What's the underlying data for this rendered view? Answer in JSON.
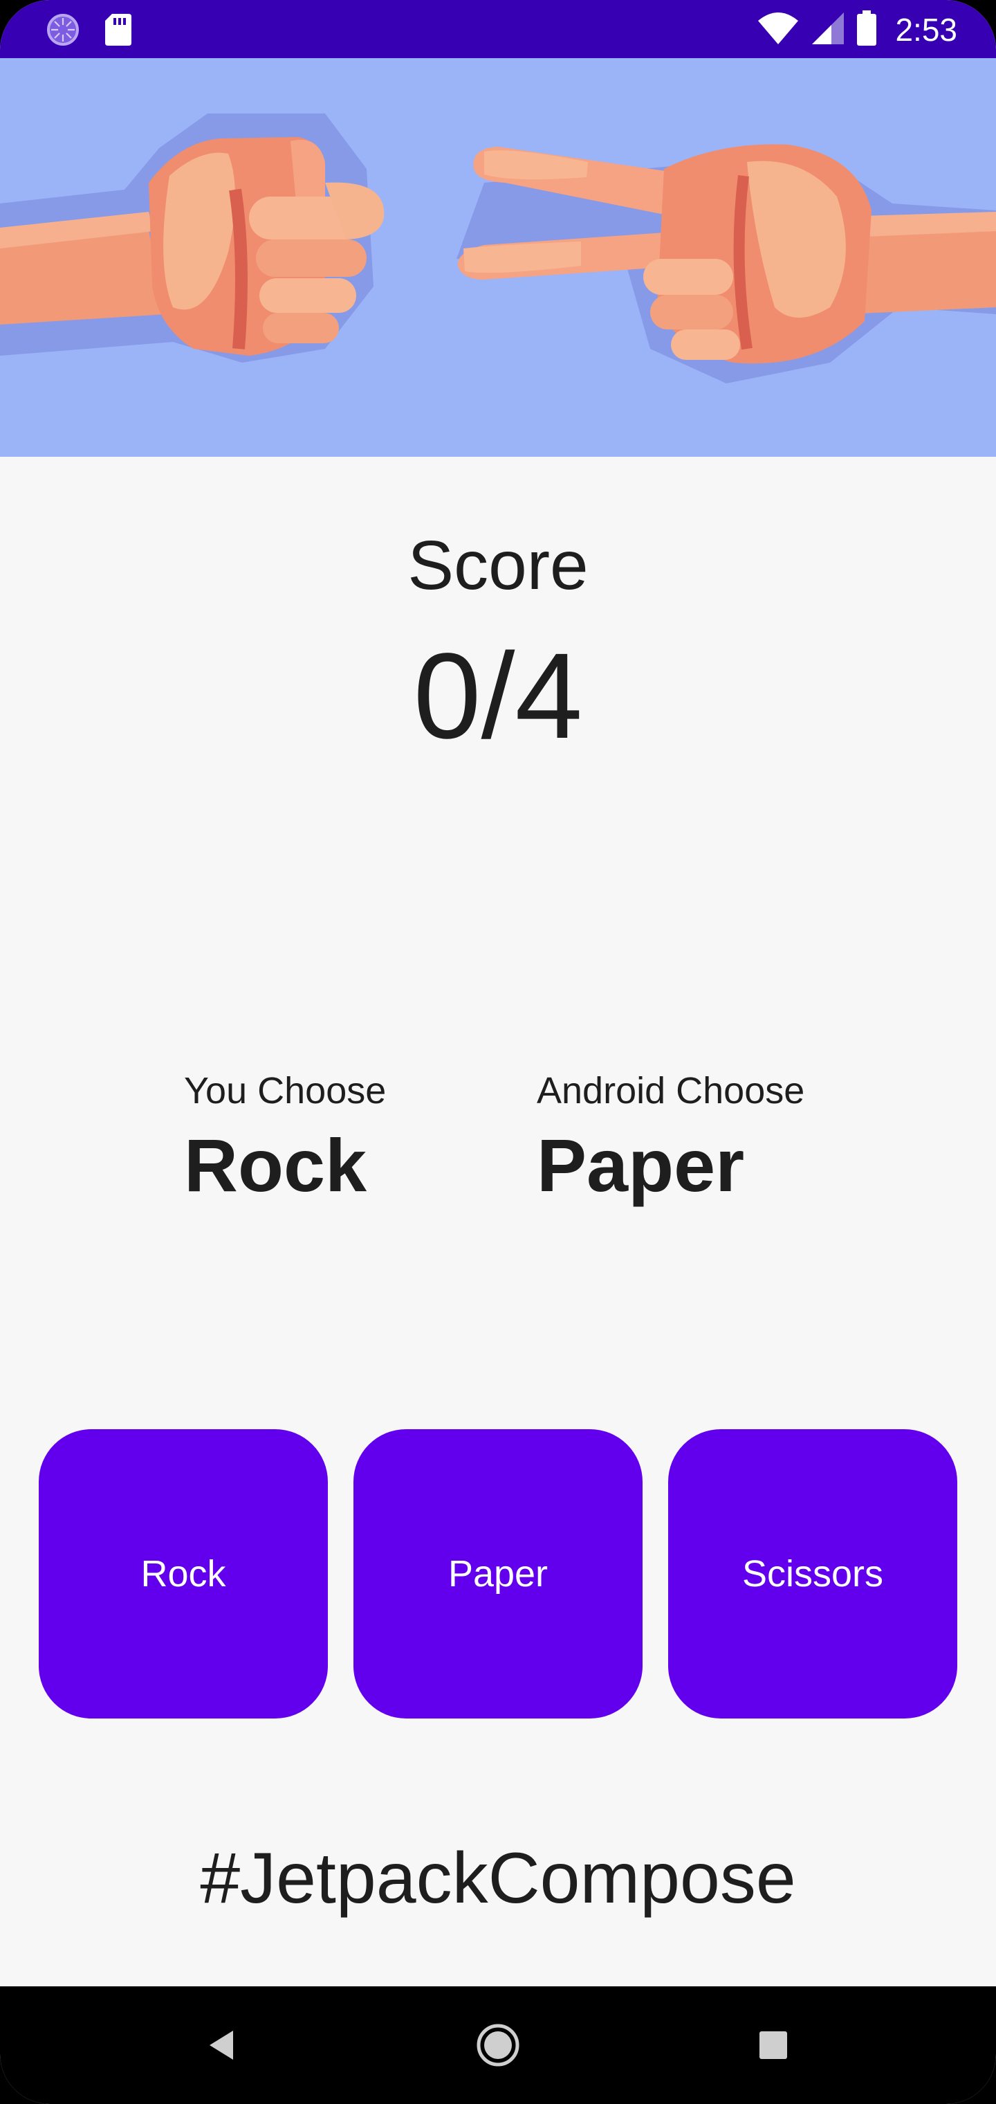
{
  "status_bar": {
    "time": "2:53",
    "icons": [
      "loading-spinner-icon",
      "sd-card-icon",
      "wifi-icon",
      "signal-icon",
      "battery-icon"
    ],
    "background": "#3700B3"
  },
  "hero": {
    "image": "rock-vs-scissors-hands-illustration",
    "background": "#9BB4F7"
  },
  "score": {
    "label": "Score",
    "value": "0/4"
  },
  "choices": {
    "you": {
      "caption": "You Choose",
      "value": "Rock"
    },
    "android": {
      "caption": "Android Choose",
      "value": "Paper"
    }
  },
  "buttons": {
    "rock": "Rock",
    "paper": "Paper",
    "scissors": "Scissors",
    "color": "#6200EE"
  },
  "footer": {
    "hashtag": "#JetpackCompose"
  },
  "nav_bar": {
    "icons": [
      "back-icon",
      "home-icon",
      "recents-icon"
    ]
  }
}
